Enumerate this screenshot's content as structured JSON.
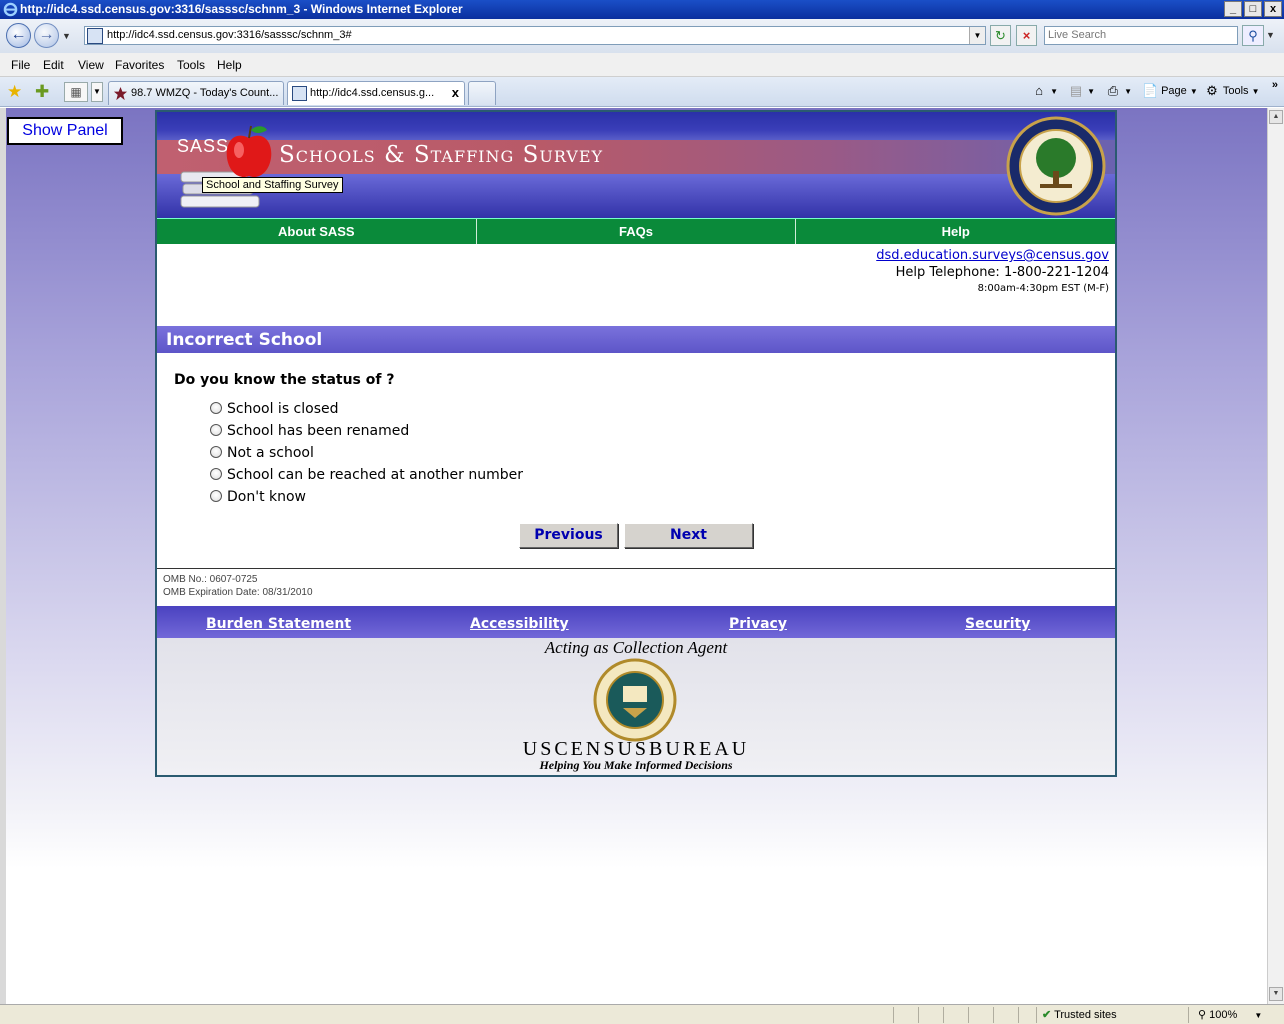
{
  "window": {
    "title": "http://idc4.ssd.census.gov:3316/sasssc/schnm_3 - Windows Internet Explorer",
    "controls": [
      "_",
      "□",
      "x"
    ]
  },
  "address": {
    "url": "http://idc4.ssd.census.gov:3316/sasssc/schnm_3#",
    "search_placeholder": "Live Search"
  },
  "menu": {
    "items": [
      "File",
      "Edit",
      "View",
      "Favorites",
      "Tools",
      "Help"
    ]
  },
  "tabs": [
    {
      "label": "98.7 WMZQ - Today's Count..."
    },
    {
      "label": "http://idc4.ssd.census.g...",
      "close": "x"
    }
  ],
  "commandbar": {
    "page_label": "Page",
    "tools_label": "Tools"
  },
  "show_panel": "Show Panel",
  "banner": {
    "abbr": "SASS",
    "title": "Schools & Staffing Survey",
    "tooltip": "School and Staffing Survey"
  },
  "topnav": [
    "About SASS",
    "FAQs",
    "Help"
  ],
  "contact": {
    "email": "dsd.education.surveys@census.gov",
    "phone": "Help Telephone: 1-800-221-1204",
    "hours": "8:00am-4:30pm EST (M-F)"
  },
  "section": {
    "title": "Incorrect School"
  },
  "question": {
    "text": "Do you know the status of ?",
    "options": [
      "School is closed",
      "School has been renamed",
      "Not a school",
      "School can be reached at another number",
      "Don't know"
    ]
  },
  "buttons": {
    "previous": "Previous",
    "next": "Next"
  },
  "omb": {
    "number": "OMB No.: 0607-0725",
    "expiration": "OMB Expiration Date: 08/31/2010"
  },
  "footer_links": [
    "Burden Statement",
    "Accessibility",
    "Privacy",
    "Security"
  ],
  "census": {
    "agent": "Acting as Collection Agent",
    "bureau": "USCENSUSBUREAU",
    "tagline": "Helping You Make Informed Decisions"
  },
  "status": {
    "zone": "Trusted sites",
    "zoom": "100%"
  },
  "colors": {
    "nav_green": "#0a8a3a",
    "section_purple": "#6a62d0",
    "link_blue": "#0000cc"
  }
}
